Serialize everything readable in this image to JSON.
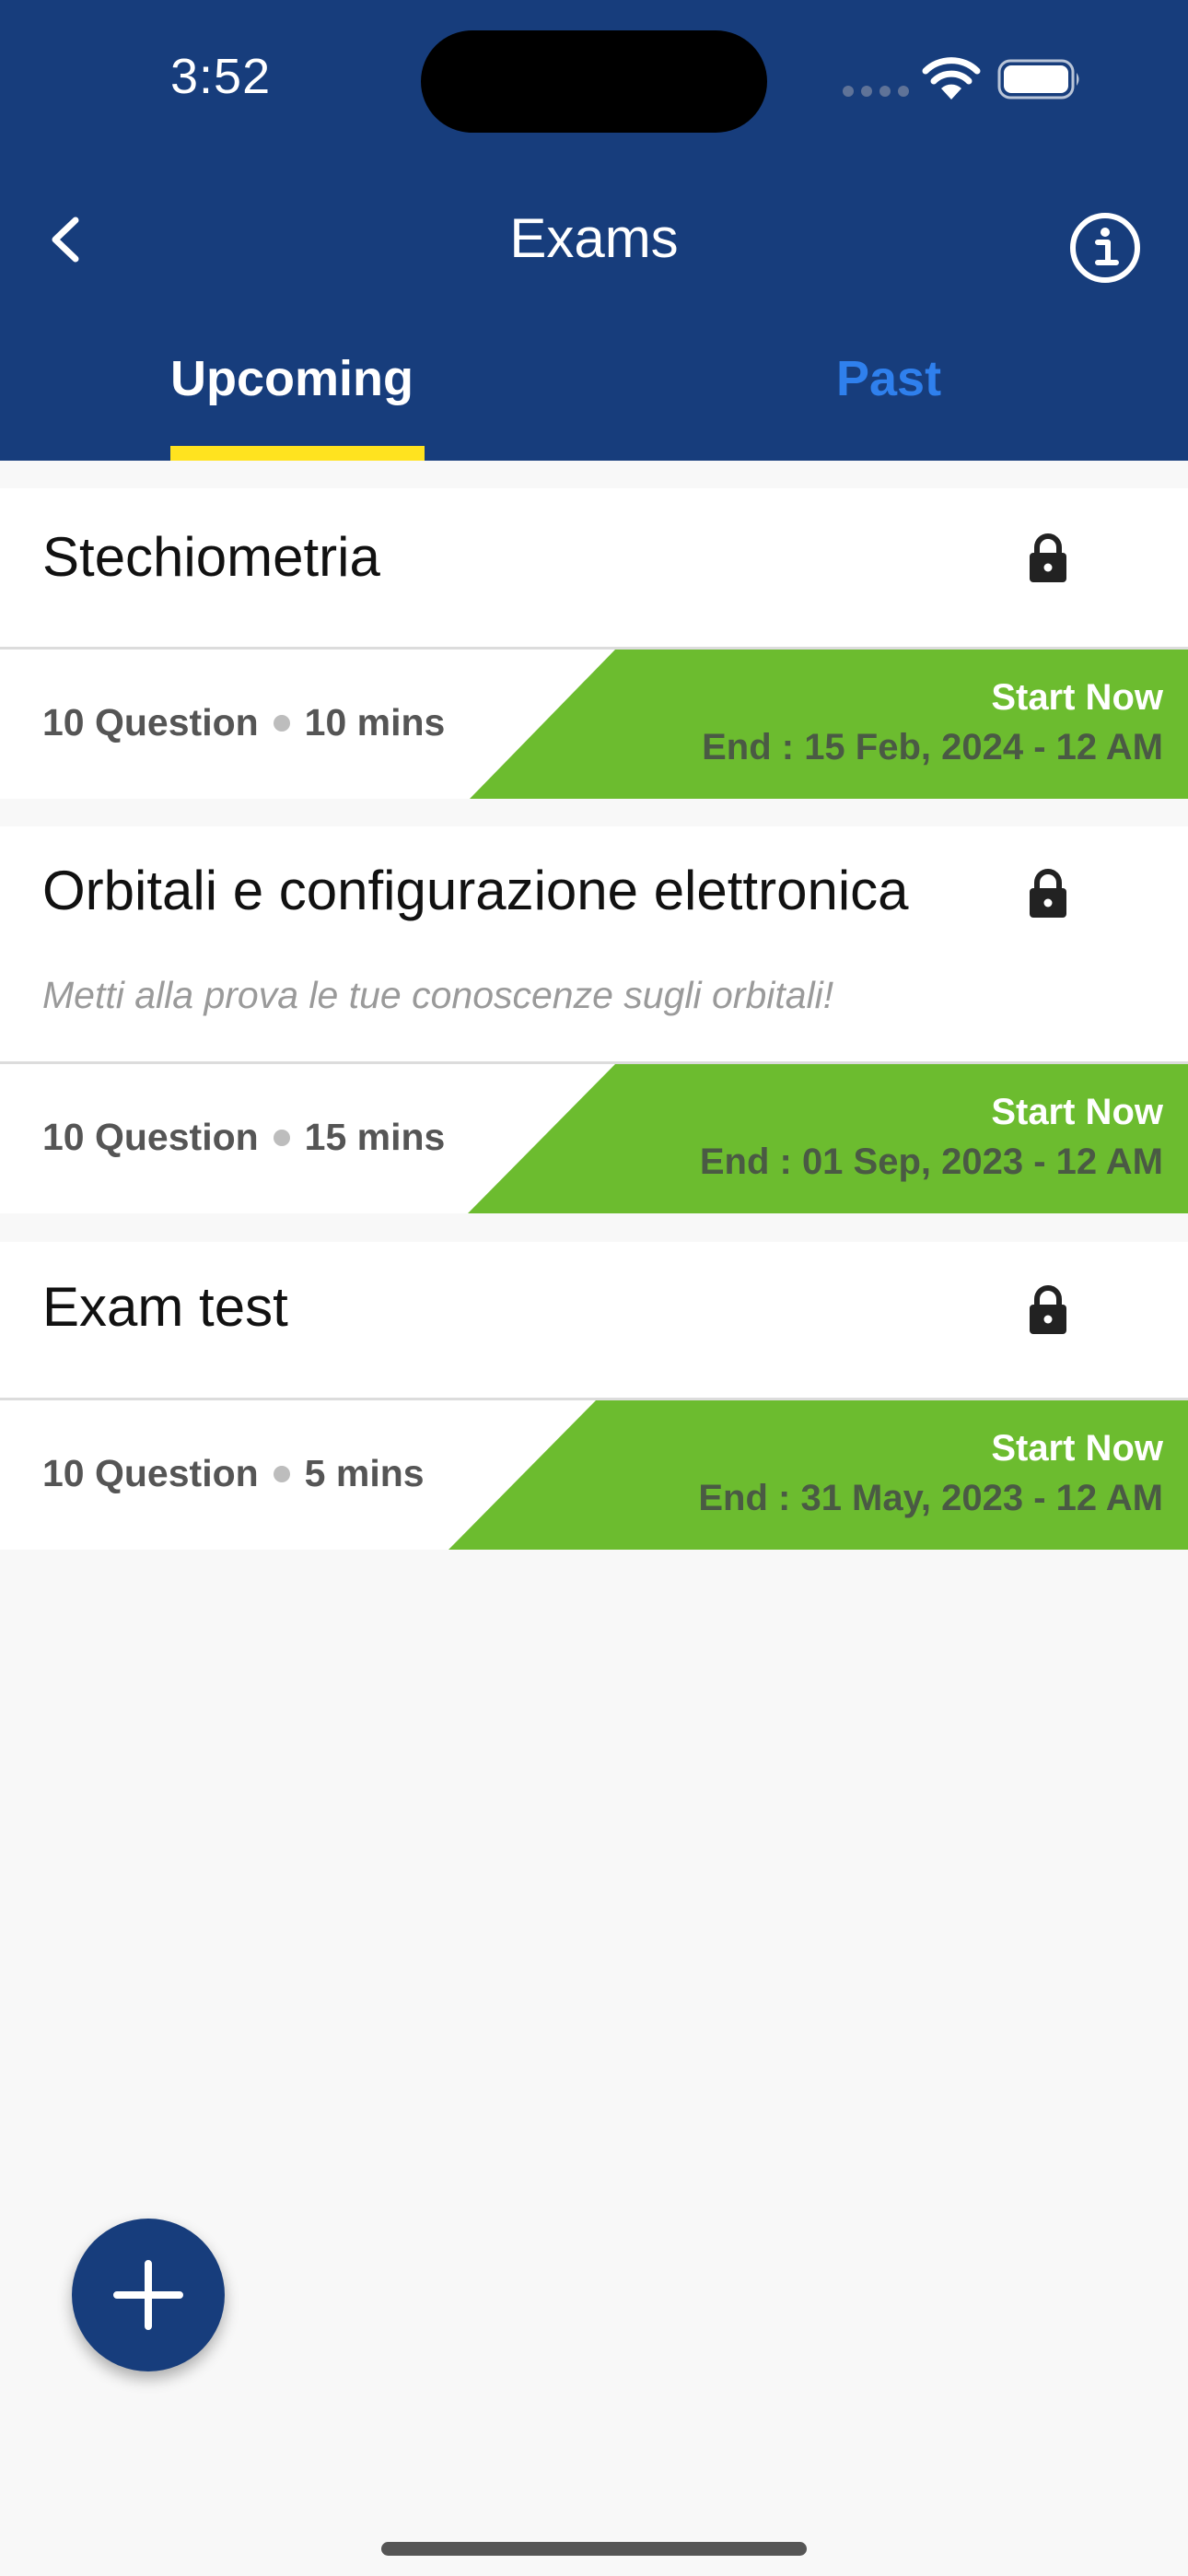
{
  "status_bar": {
    "time": "3:52"
  },
  "header": {
    "title": "Exams",
    "back_icon": "chevron-left-icon",
    "info_icon": "info-circle-icon",
    "background_color": "#173d7c"
  },
  "tabs": [
    {
      "label": "Upcoming",
      "selected": true
    },
    {
      "label": "Past",
      "selected": false
    }
  ],
  "colors": {
    "tab_indicator": "#ffe31f",
    "start_band": "#6cbc2f",
    "inactive_tab": "#2f80ed"
  },
  "exams": [
    {
      "title": "Stechiometria",
      "description": "",
      "questions": "10 Question",
      "duration": "10 mins",
      "action": "Start Now",
      "end": "End : 15 Feb, 2024 - 12 AM",
      "locked": true
    },
    {
      "title": "Orbitali e configurazione elettronica",
      "description": "Metti alla prova le tue conoscenze sugli orbitali!",
      "questions": "10 Question",
      "duration": "15 mins",
      "action": "Start Now",
      "end": "End : 01 Sep, 2023 - 12 AM",
      "locked": true
    },
    {
      "title": "Exam test",
      "description": "",
      "questions": "10 Question",
      "duration": "5 mins",
      "action": "Start Now",
      "end": "End : 31 May, 2023 - 12 AM",
      "locked": true
    }
  ],
  "fab": {
    "icon": "plus-icon"
  }
}
